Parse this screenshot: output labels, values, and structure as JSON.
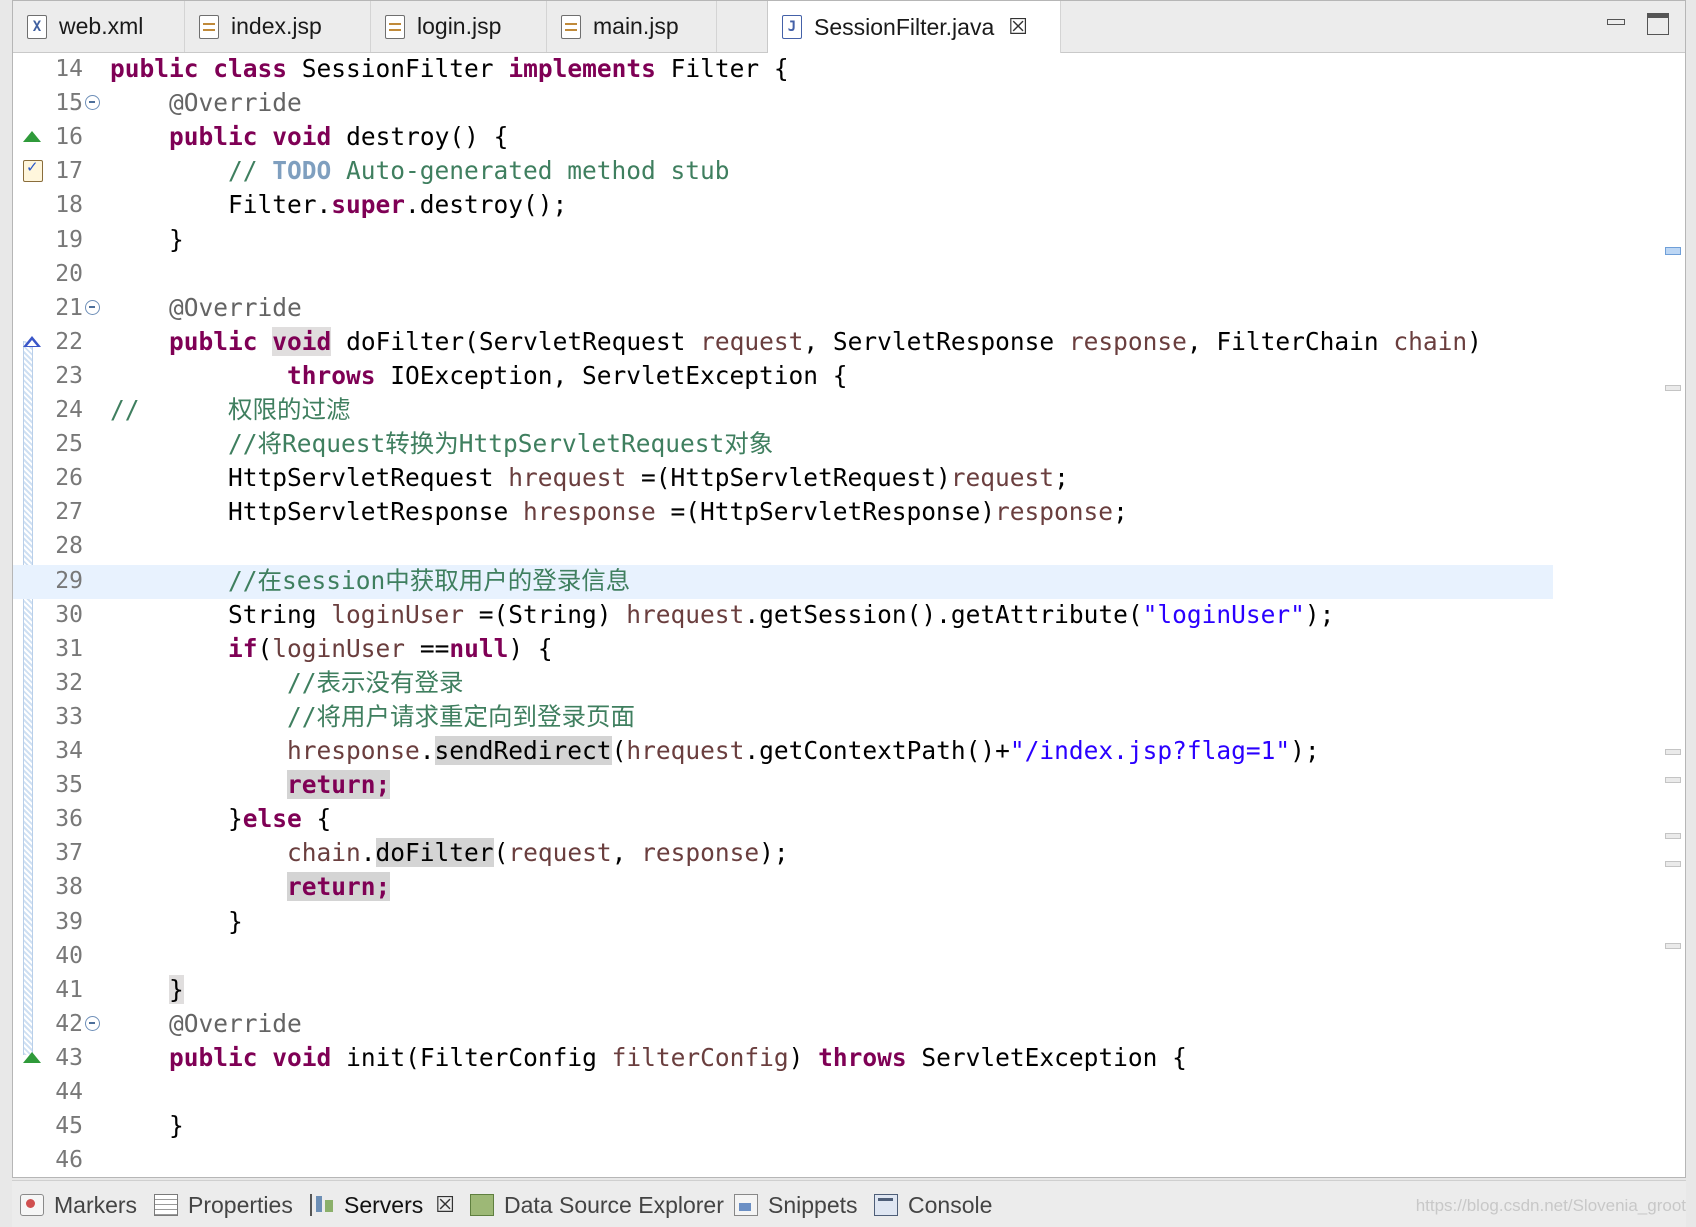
{
  "tabs": [
    {
      "label": "web.xml",
      "icon": "xml-file-icon",
      "glyph": "X"
    },
    {
      "label": "index.jsp",
      "icon": "jsp-file-icon"
    },
    {
      "label": "login.jsp",
      "icon": "jsp-file-icon"
    },
    {
      "label": "main.jsp",
      "icon": "jsp-file-icon"
    },
    {
      "label": "SessionFilter.java",
      "icon": "java-file-icon",
      "glyph": "J",
      "active": true
    }
  ],
  "tab_close_glyph": "☒",
  "editor": {
    "current_line": 29,
    "lines": [
      {
        "n": "14",
        "html": "<span class=\"kw\">public</span> <span class=\"kw\">class</span> SessionFilter <span class=\"kw\">implements</span> Filter {"
      },
      {
        "n": "15",
        "fold": true,
        "html": "    <span class=\"ann\">@Override</span>"
      },
      {
        "n": "16",
        "marker": "override",
        "html": "    <span class=\"kw\">public</span> <span class=\"kw\">void</span> destroy() {"
      },
      {
        "n": "17",
        "marker": "task",
        "html": "        <span class=\"cmt\">// </span><span class=\"todo\">TODO</span><span class=\"cmt\"> Auto-generated method stub</span>"
      },
      {
        "n": "18",
        "html": "        Filter.<span class=\"kw\">super</span>.destroy();"
      },
      {
        "n": "19",
        "html": "    }"
      },
      {
        "n": "20",
        "html": ""
      },
      {
        "n": "21",
        "fold": true,
        "html": "    <span class=\"ann\">@Override</span>"
      },
      {
        "n": "22",
        "marker": "implement",
        "html": "    <span class=\"kw\">public</span> <span class=\"kw hl2\">void</span> doFilter(ServletRequest <span class=\"var\">request</span>, ServletResponse <span class=\"var\">response</span>, FilterChain <span class=\"var\">chain</span>)"
      },
      {
        "n": "23",
        "html": "            <span class=\"kw\">throws</span> IOException, ServletException {"
      },
      {
        "n": "24",
        "html": "<span class=\"cmt\">//      权限的过滤</span>"
      },
      {
        "n": "25",
        "html": "        <span class=\"cmt\">//将Request转换为HttpServletRequest对象</span>"
      },
      {
        "n": "26",
        "html": "        HttpServletRequest <span class=\"var\">hrequest</span> =(HttpServletRequest)<span class=\"var\">request</span>;"
      },
      {
        "n": "27",
        "html": "        HttpServletResponse <span class=\"var\">hresponse</span> =(HttpServletResponse)<span class=\"var\">response</span>;"
      },
      {
        "n": "28",
        "html": ""
      },
      {
        "n": "29",
        "html": "        <span class=\"cmt\">//在session中获取用户的登录信息</span>"
      },
      {
        "n": "30",
        "html": "        String <span class=\"var\">loginUser</span> =(String) <span class=\"var\">hrequest</span>.getSession().getAttribute(<span class=\"str\">\"loginUser\"</span>);"
      },
      {
        "n": "31",
        "html": "        <span class=\"kw\">if</span>(<span class=\"var\">loginUser</span> ==<span class=\"kw\">null</span>) {"
      },
      {
        "n": "32",
        "html": "            <span class=\"cmt\">//表示没有登录</span>"
      },
      {
        "n": "33",
        "html": "            <span class=\"cmt\">//将用户请求重定向到登录页面</span>"
      },
      {
        "n": "34",
        "html": "            <span class=\"var\">hresponse</span>.<span class=\"hl\">sendRedirect</span>(<span class=\"var\">hrequest</span>.getContextPath()+<span class=\"str\">\"/index.jsp?flag=1\"</span>);"
      },
      {
        "n": "35",
        "html": "            <span class=\"kw hl\">return;</span>"
      },
      {
        "n": "36",
        "html": "        }<span class=\"kw\">else</span> {"
      },
      {
        "n": "37",
        "html": "            <span class=\"var\">chain</span>.<span class=\"hl\">doFilter</span>(<span class=\"var\">request</span>, <span class=\"var\">response</span>);"
      },
      {
        "n": "38",
        "html": "            <span class=\"kw hl\">return;</span>"
      },
      {
        "n": "39",
        "html": "        }"
      },
      {
        "n": "40",
        "html": ""
      },
      {
        "n": "41",
        "html": "    <span class=\"hl2\">}</span>"
      },
      {
        "n": "42",
        "fold": true,
        "html": "    <span class=\"ann\">@Override</span>"
      },
      {
        "n": "43",
        "marker": "override",
        "html": "    <span class=\"kw\">public</span> <span class=\"kw\">void</span> init(FilterConfig <span class=\"var\">filterConfig</span>) <span class=\"kw\">throws</span> ServletException {"
      },
      {
        "n": "44",
        "html": ""
      },
      {
        "n": "45",
        "html": "    }"
      },
      {
        "n": "46",
        "html": ""
      }
    ]
  },
  "bottom_tabs": [
    {
      "label": "Markers",
      "icon": "markers-icon",
      "cls": "markers"
    },
    {
      "label": "Properties",
      "icon": "properties-icon",
      "cls": "props"
    },
    {
      "label": "Servers",
      "icon": "servers-icon",
      "cls": "servers",
      "active": true
    },
    {
      "label": "Data Source Explorer",
      "icon": "data-source-explorer-icon",
      "cls": "datasource"
    },
    {
      "label": "Snippets",
      "icon": "snippets-icon",
      "cls": "snippets"
    },
    {
      "label": "Console",
      "icon": "console-icon",
      "cls": "console"
    }
  ],
  "watermark": "https://blog.csdn.net/Slovenia_groot"
}
